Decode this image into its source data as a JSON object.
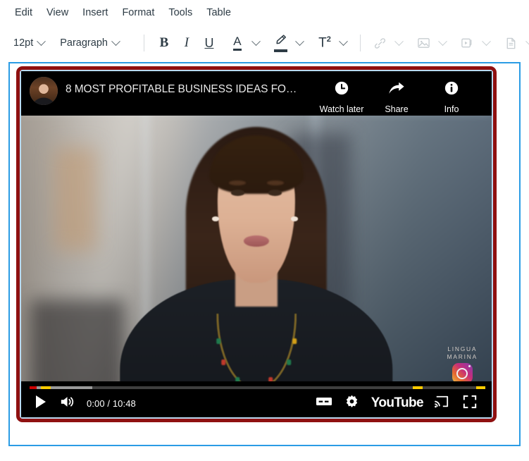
{
  "menubar": {
    "items": [
      {
        "label": "Edit",
        "name": "menu-edit"
      },
      {
        "label": "View",
        "name": "menu-view"
      },
      {
        "label": "Insert",
        "name": "menu-insert"
      },
      {
        "label": "Format",
        "name": "menu-format"
      },
      {
        "label": "Tools",
        "name": "menu-tools"
      },
      {
        "label": "Table",
        "name": "menu-table"
      }
    ]
  },
  "toolbar": {
    "font_size": "12pt",
    "block_format": "Paragraph",
    "bold_label": "B",
    "italic_label": "I",
    "underline_label": "U",
    "text_color_label": "A",
    "superscript_label": "T",
    "superscript_sup": "2",
    "icons": {
      "link": "link-icon",
      "image": "image-icon",
      "media": "media-icon",
      "document": "document-icon",
      "more": "kebab-menu-icon",
      "highlight": "highlight-pen-icon"
    }
  },
  "editor": {
    "video": {
      "title": "8 MOST PROFITABLE BUSINESS IDEAS FO…",
      "actions": [
        {
          "label": "Watch later",
          "icon": "clock-icon",
          "name": "watch-later-button"
        },
        {
          "label": "Share",
          "icon": "share-arrow-icon",
          "name": "share-button"
        },
        {
          "label": "Info",
          "icon": "info-circle-icon",
          "name": "info-button"
        }
      ],
      "controls": {
        "play_icon": "play-icon",
        "volume_icon": "volume-icon",
        "time": "0:00 / 10:48",
        "current_time": "0:00",
        "duration": "10:48",
        "cc_label": "CC",
        "settings_icon": "gear-icon",
        "brand": "YouTube",
        "cast_icon": "cast-icon",
        "fullscreen_icon": "fullscreen-icon"
      },
      "progress": {
        "played_percent": 1.6,
        "buffered_percent": 13.8,
        "chapter_markers": [
          2.5,
          84.5,
          98.5
        ]
      },
      "watermark": {
        "line1": "LINGUA",
        "line2": "MARINA",
        "badge": "instagram-icon"
      }
    },
    "selection_color": "#8f1010",
    "focus_color": "#2b9ce5"
  }
}
